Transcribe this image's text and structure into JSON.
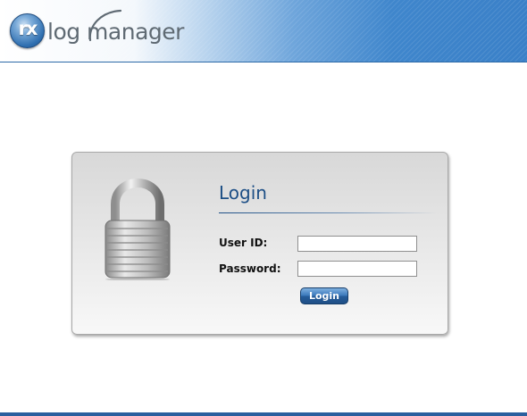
{
  "header": {
    "logo_badge": "rx",
    "logo_word": "log manager",
    "brand_color": "#3f86cc"
  },
  "login": {
    "title": "Login",
    "user_id_label": "User ID:",
    "user_id_value": "",
    "password_label": "Password:",
    "password_value": "",
    "submit_label": "Login",
    "icon": "padlock-icon"
  }
}
